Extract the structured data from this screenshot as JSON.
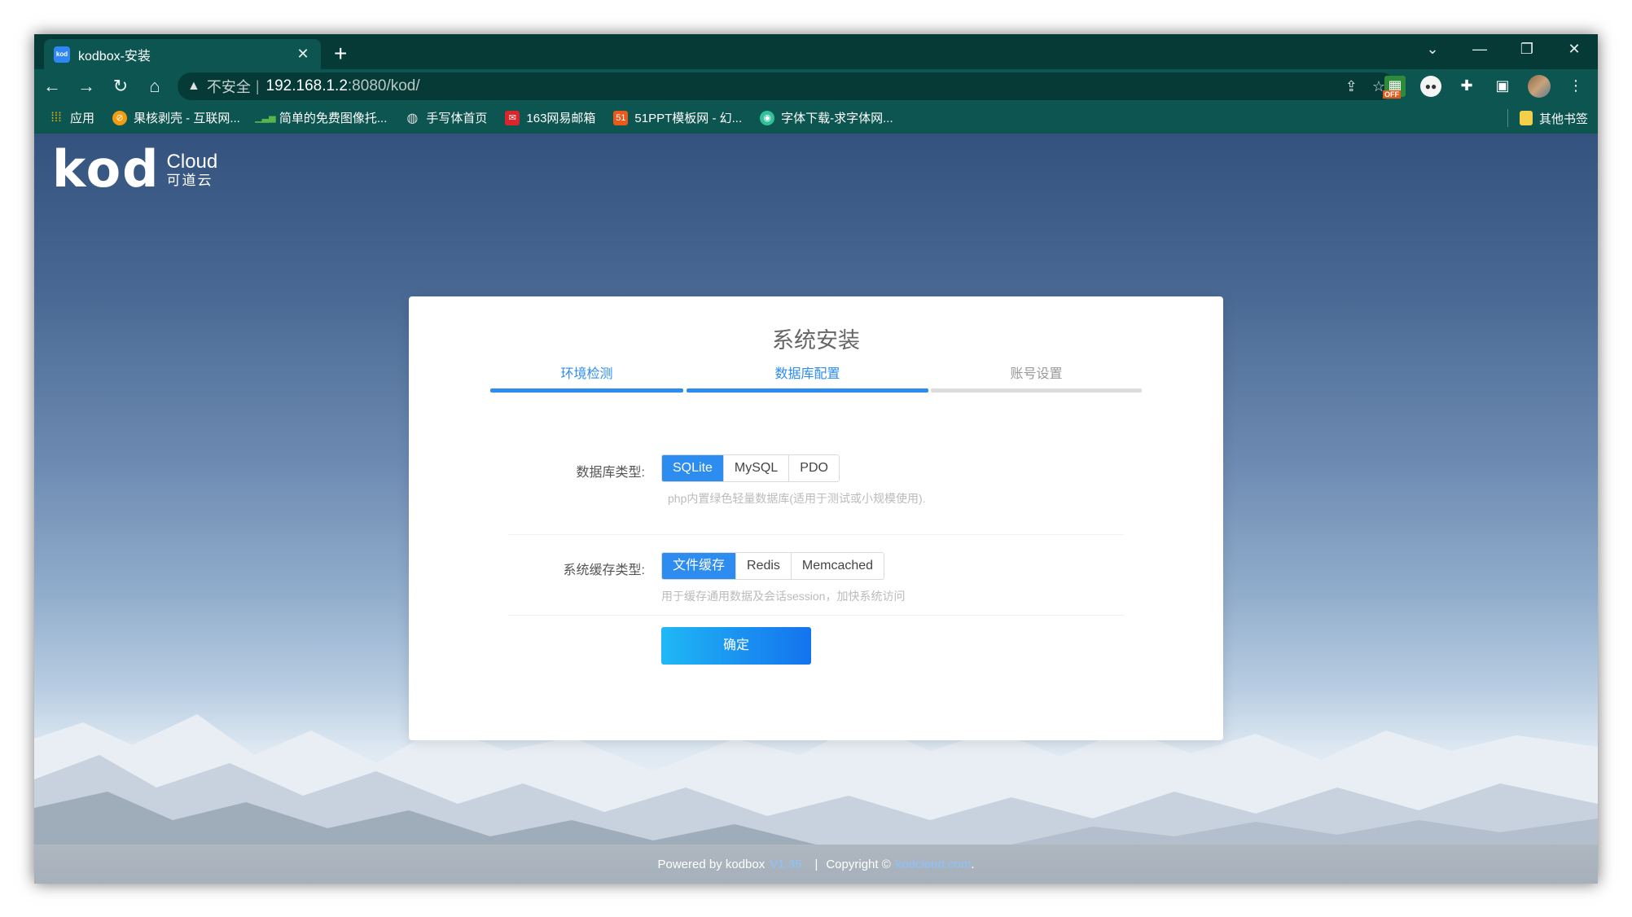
{
  "browser": {
    "tab_title": "kodbox-安装",
    "tab_favicon": "kod",
    "new_tab": "+",
    "address": {
      "insecure_label": "不安全",
      "separator": "|",
      "host": "192.168.1.2",
      "path": ":8080/kod/"
    },
    "extension_off_label": "OFF",
    "bookmarks": [
      {
        "label": "应用",
        "icon": "apps-grid-icon",
        "color": "#f2b400"
      },
      {
        "label": "果核剥壳 - 互联网...",
        "icon": "orange-circle-icon",
        "color": "#f39c12"
      },
      {
        "label": "简单的免费图像托...",
        "icon": "bars-chart-icon",
        "color": "#59b44b"
      },
      {
        "label": "手写体首页",
        "icon": "globe-icon",
        "color": "#dddddd"
      },
      {
        "label": "163网易邮箱",
        "icon": "netease-mail-icon",
        "color": "#d9262c"
      },
      {
        "label": "51PPT模板网 - 幻...",
        "icon": "51ppt-icon",
        "color": "#e85a1b"
      },
      {
        "label": "字体下载-求字体网...",
        "icon": "location-pin-icon",
        "color": "#2fc19a"
      }
    ],
    "other_bookmarks": "其他书签"
  },
  "page": {
    "logo": {
      "main": "kod",
      "cloud": "Cloud",
      "cn": "可道云"
    },
    "card": {
      "title": "系统安装",
      "steps": [
        {
          "label": "环境检测",
          "state": "done"
        },
        {
          "label": "数据库配置",
          "state": "done"
        },
        {
          "label": "账号设置",
          "state": "todo"
        }
      ],
      "db": {
        "label": "数据库类型:",
        "options": [
          "SQLite",
          "MySQL",
          "PDO"
        ],
        "selected": "SQLite",
        "hint": "php内置绿色轻量数据库(适用于测试或小规模使用)."
      },
      "cache": {
        "label": "系统缓存类型:",
        "options": [
          "文件缓存",
          "Redis",
          "Memcached"
        ],
        "selected": "文件缓存",
        "hint": "用于缓存通用数据及会话session，加快系统访问"
      },
      "submit": "确定"
    },
    "footer": {
      "powered": "Powered by kodbox",
      "version": "V1.35",
      "separator": "|",
      "copyright": "Copyright ©",
      "site": "kodcloud.com",
      "end": "."
    }
  },
  "colors": {
    "accent": "#2d8cf0",
    "chrome_dark": "#053a37",
    "chrome_mid": "#0d5550"
  }
}
